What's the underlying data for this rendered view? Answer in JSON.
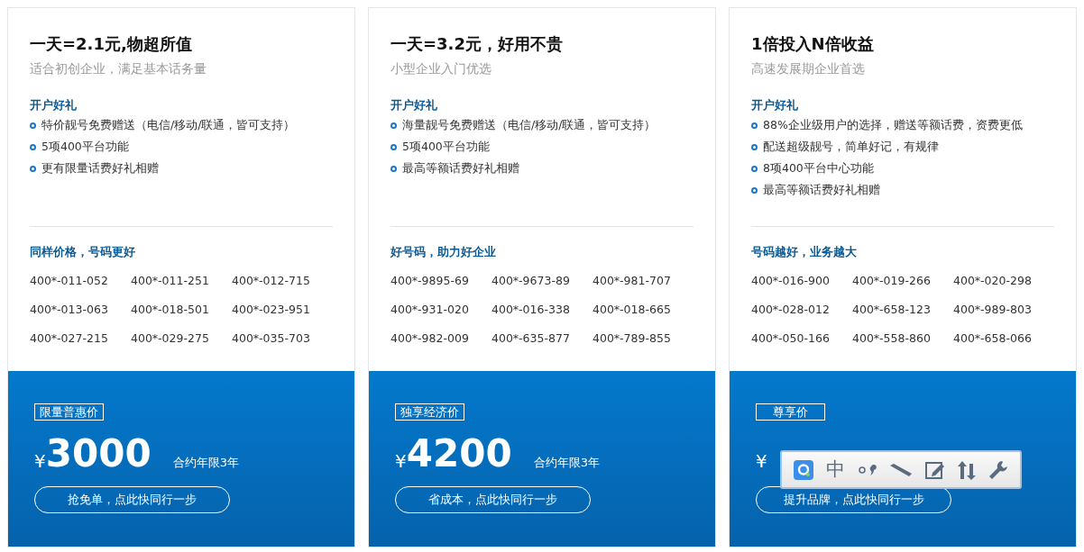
{
  "plans": [
    {
      "title": "一天=2.1元,物超所值",
      "subtitle": "适合初创企业，满足基本话务量",
      "gift_heading": "开户好礼",
      "gifts": [
        "特价靓号免费赠送（电信/移动/联通，皆可支持）",
        "5项400平台功能",
        "更有限量话费好礼相赠"
      ],
      "numbers_heading": "同样价格，号码更好",
      "numbers": [
        "400*-011-052",
        "400*-011-251",
        "400*-012-715",
        "400*-013-063",
        "400*-018-501",
        "400*-023-951",
        "400*-027-215",
        "400*-029-275",
        "400*-035-703"
      ],
      "badge": "限量普惠价",
      "currency": "¥",
      "price": "3000",
      "term": "合约年限3年",
      "cta": "抢免单，点此快同行一步"
    },
    {
      "title": "一天=3.2元，好用不贵",
      "subtitle": "小型企业入门优选",
      "gift_heading": "开户好礼",
      "gifts": [
        "海量靓号免费赠送（电信/移动/联通，皆可支持）",
        "5项400平台功能",
        "最高等额话费好礼相赠"
      ],
      "numbers_heading": "好号码，助力好企业",
      "numbers": [
        "400*-9895-69",
        "400*-9673-89",
        "400*-981-707",
        "400*-931-020",
        "400*-016-338",
        "400*-018-665",
        "400*-982-009",
        "400*-635-877",
        "400*-789-855"
      ],
      "badge": "独享经济价",
      "currency": "¥",
      "price": "4200",
      "term": "合约年限3年",
      "cta": "省成本，点此快同行一步"
    },
    {
      "title": "1倍投入N倍收益",
      "subtitle": "高速发展期企业首选",
      "gift_heading": "开户好礼",
      "gifts": [
        "88%企业级用户的选择，赠送等额话费，资费更低",
        "配送超级靓号，简单好记，有规律",
        "8项400平台中心功能",
        "最高等额话费好礼相赠"
      ],
      "numbers_heading": "号码越好，业务越大",
      "numbers": [
        "400*-016-900",
        "400*-019-266",
        "400*-020-298",
        "400*-028-012",
        "400*-658-123",
        "400*-989-803",
        "400*-050-166",
        "400*-558-860",
        "400*-658-066"
      ],
      "badge": "尊享价",
      "currency": "¥",
      "cta": "提升品牌，点此快同行一步"
    }
  ],
  "ime_toolbar": {
    "mode_label": "中"
  }
}
